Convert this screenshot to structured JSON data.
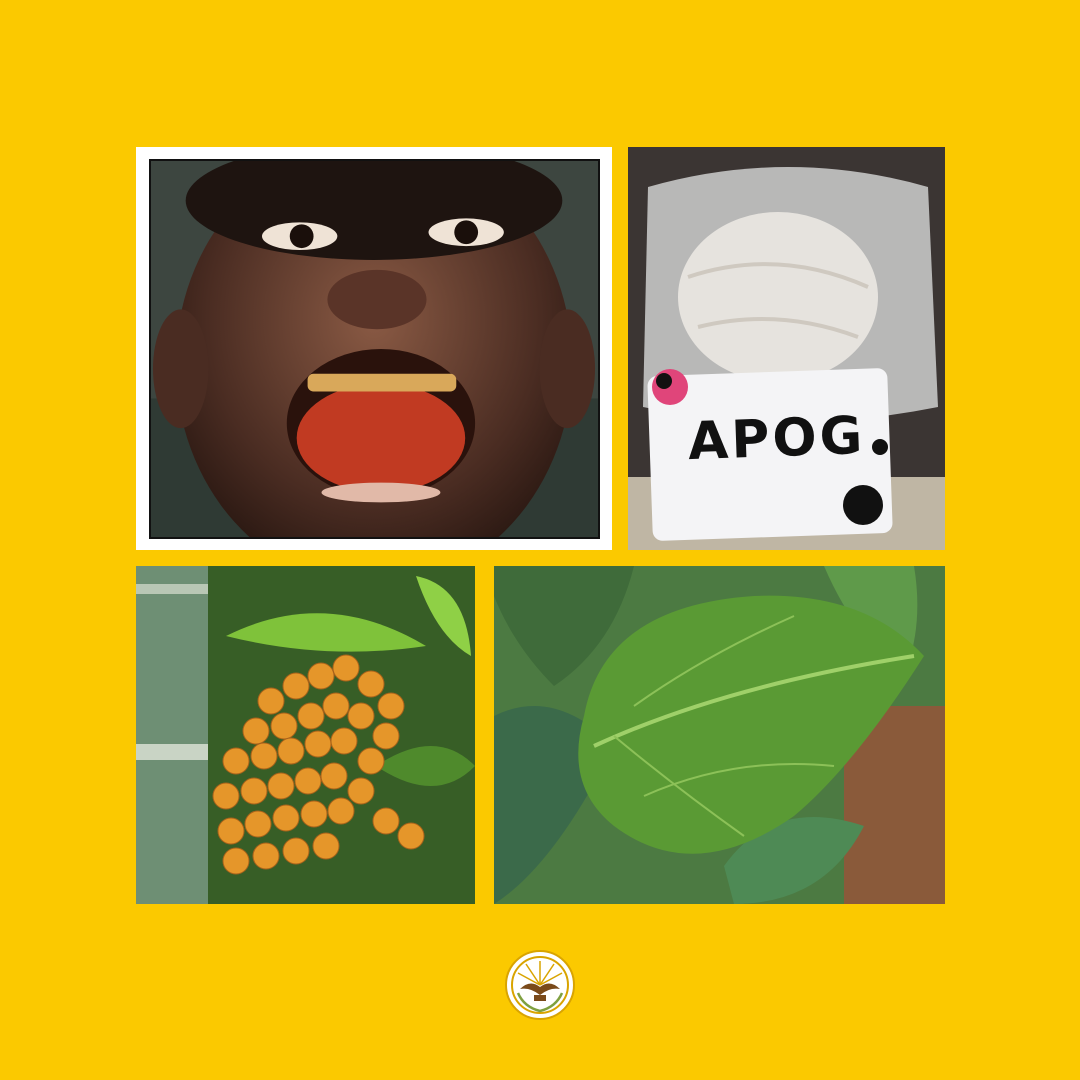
{
  "background_color": "#FBC900",
  "photos": {
    "child_red_mouth": {
      "icon": "smiling-child-photo"
    },
    "lime_powder_bag": {
      "icon": "lime-powder-bag-photo",
      "card_text": "APOG"
    },
    "areca_nut_cluster": {
      "icon": "areca-nut-photo"
    },
    "betel_leaf": {
      "icon": "betel-leaf-photo"
    }
  },
  "emblem": {
    "icon": "eagle-wreath-seal-icon",
    "color": "#D9A400"
  }
}
